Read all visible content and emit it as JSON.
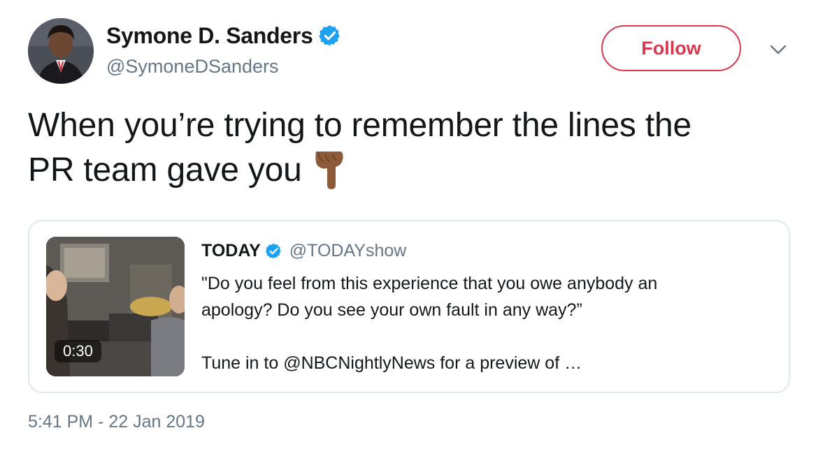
{
  "tweet": {
    "author": {
      "display_name": "Symone D. Sanders",
      "handle": "@SymoneDSanders",
      "verified": true
    },
    "follow_label": "Follow",
    "text_line1": "When you’re trying to remember the lines the",
    "text_line2": "PR team gave you",
    "emoji": "backhand-index-pointing-down-medium-dark-skin",
    "timestamp": "5:41 PM - 22 Jan 2019"
  },
  "quoted_tweet": {
    "display_name": "TODAY",
    "handle": "@TODAYshow",
    "verified": true,
    "text_line1": "\"Do you feel from this experience that you owe anybody an",
    "text_line2": "apology? Do you see your own fault in any way?”",
    "text_line3": "Tune in to @NBCNightlyNews for a preview of …",
    "video_duration": "0:30"
  },
  "colors": {
    "follow_accent": "#d9394f",
    "verified_blue": "#1da1f2",
    "secondary_text": "#657786",
    "border": "#e1e8ed"
  },
  "icons": [
    "verified-badge-icon",
    "chevron-down-icon",
    "pointing-down-emoji"
  ]
}
